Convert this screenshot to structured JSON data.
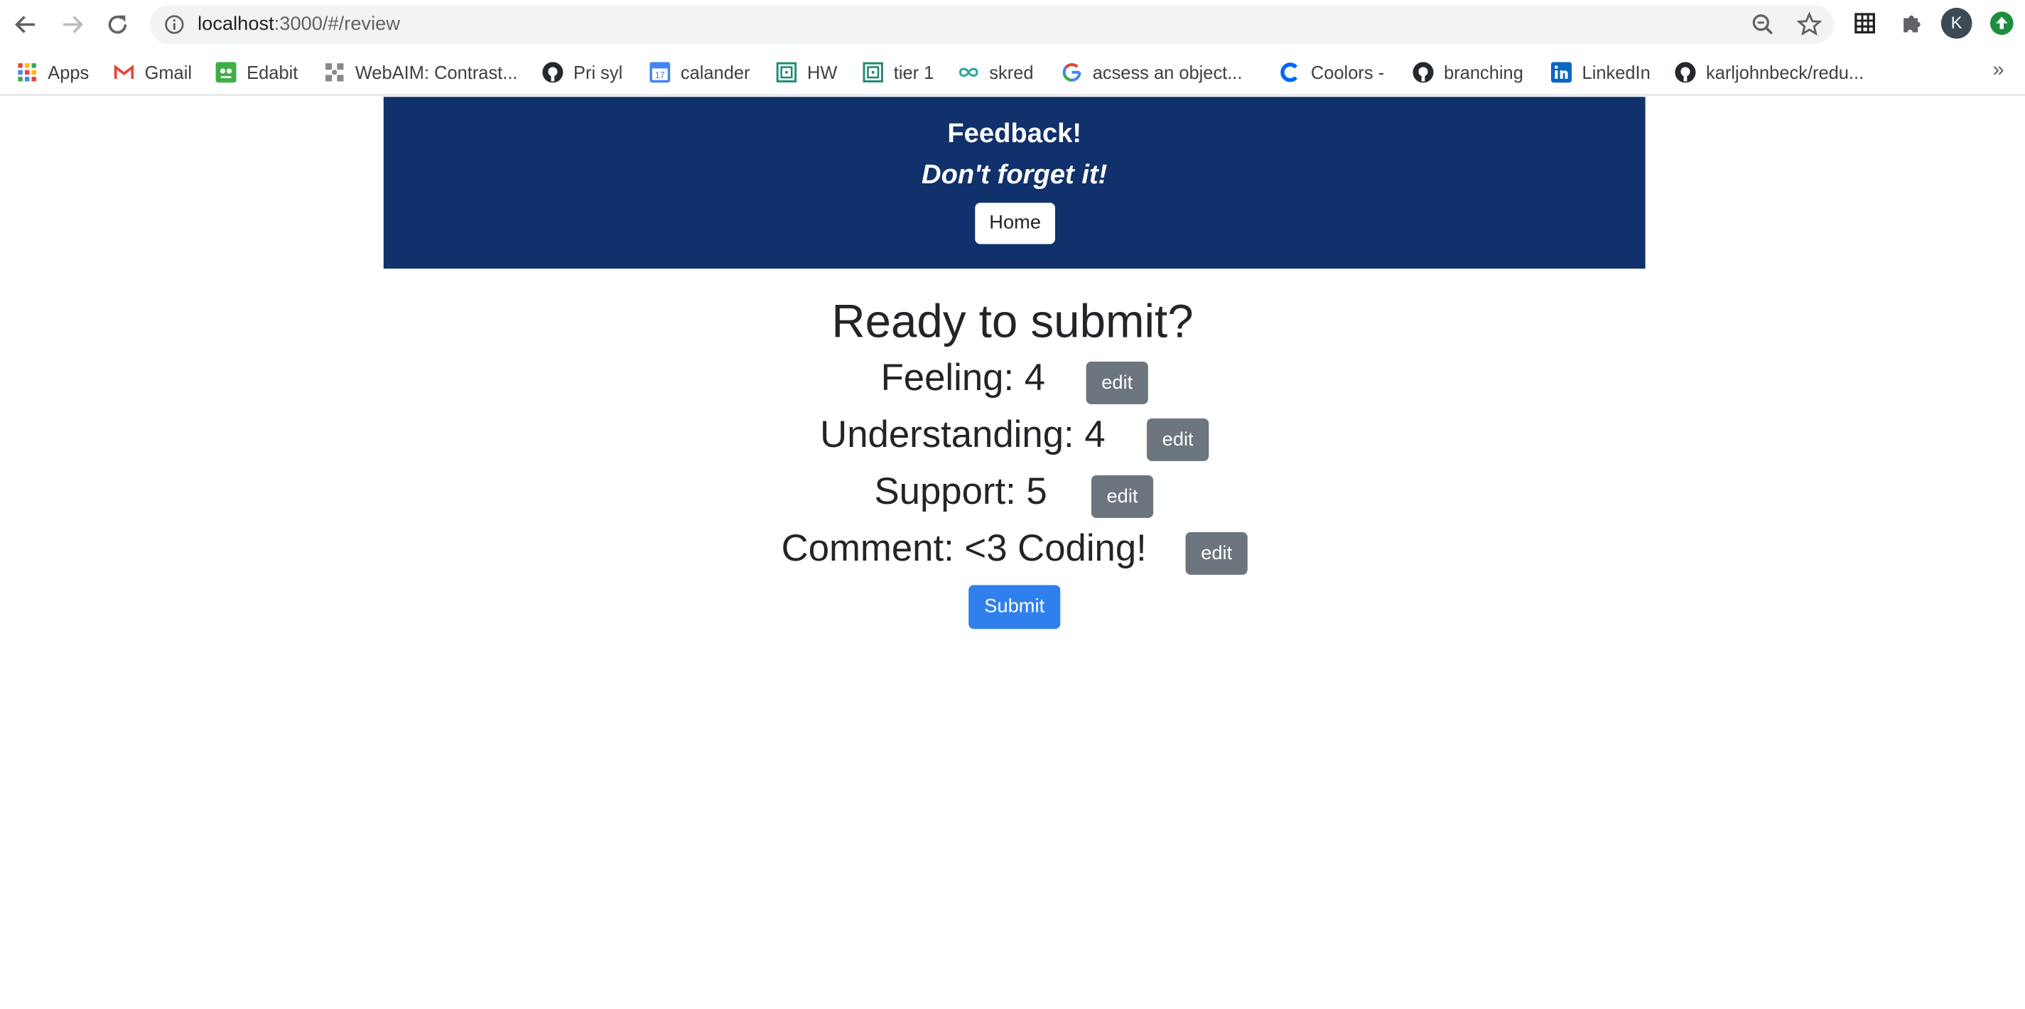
{
  "browser": {
    "url_host": "localhost",
    "url_path": ":3000/#/review",
    "profile_initial": "K",
    "bookmarks": [
      {
        "label": "Apps",
        "icon": "apps-grid-icon"
      },
      {
        "label": "Gmail",
        "icon": "gmail-icon"
      },
      {
        "label": "Edabit",
        "icon": "edabit-icon"
      },
      {
        "label": "WebAIM: Contrast...",
        "icon": "webaim-icon"
      },
      {
        "label": "Pri syl",
        "icon": "github-icon"
      },
      {
        "label": "calander",
        "icon": "calendar-icon"
      },
      {
        "label": "HW",
        "icon": "maze-icon"
      },
      {
        "label": "tier 1",
        "icon": "maze-icon"
      },
      {
        "label": "skred",
        "icon": "infinity-icon"
      },
      {
        "label": "acsess an object...",
        "icon": "google-icon"
      },
      {
        "label": "Coolors -",
        "icon": "coolors-icon"
      },
      {
        "label": "branching",
        "icon": "github-icon"
      },
      {
        "label": "LinkedIn",
        "icon": "linkedin-icon"
      },
      {
        "label": "karljohnbeck/redu...",
        "icon": "github-icon"
      }
    ],
    "more_label": "»"
  },
  "header": {
    "title": "Feedback!",
    "tagline": "Don't forget it!",
    "home_label": "Home",
    "bg_color": "#10316b"
  },
  "review": {
    "title": "Ready to submit?",
    "rows": [
      {
        "label": "Feeling: 4",
        "edit_label": "edit"
      },
      {
        "label": "Understanding: 4",
        "edit_label": "edit"
      },
      {
        "label": "Support: 5",
        "edit_label": "edit"
      },
      {
        "label": "Comment: <3 Coding!",
        "edit_label": "edit"
      }
    ],
    "submit_label": "Submit",
    "submit_color": "#2f80ed",
    "edit_color": "#6c757d"
  }
}
